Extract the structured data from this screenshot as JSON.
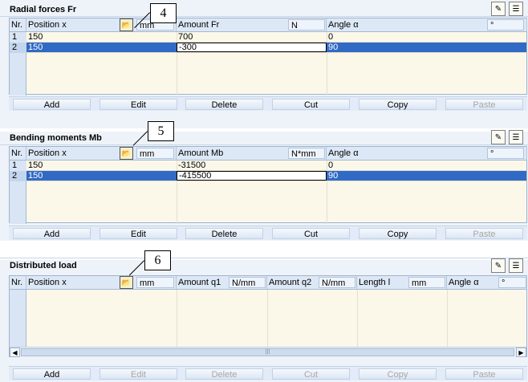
{
  "icons": {
    "pick": "folder-pick-icon",
    "edit_chart": "chart-edit-icon",
    "notes": "notes-icon"
  },
  "buttons": [
    {
      "label": "Add"
    },
    {
      "label": "Edit"
    },
    {
      "label": "Delete"
    },
    {
      "label": "Cut"
    },
    {
      "label": "Copy"
    },
    {
      "label": "Paste"
    }
  ],
  "radial": {
    "title": "Radial forces Fr",
    "callout": "4",
    "headers": {
      "nr": "Nr.",
      "pos": "Position x",
      "pos_unit": "mm",
      "amount": "Amount Fr",
      "amount_unit": "N",
      "angle": "Angle α",
      "angle_unit": "°"
    },
    "rows": [
      {
        "nr": "1",
        "pos": "150",
        "amount": "700",
        "angle": "0"
      },
      {
        "nr": "2",
        "pos": "150",
        "amount": "-300",
        "angle": "90"
      }
    ]
  },
  "bending": {
    "title": "Bending moments Mb",
    "callout": "5",
    "headers": {
      "nr": "Nr.",
      "pos": "Position x",
      "pos_unit": "mm",
      "amount": "Amount Mb",
      "amount_unit": "N*mm",
      "angle": "Angle α",
      "angle_unit": "°"
    },
    "rows": [
      {
        "nr": "1",
        "pos": "150",
        "amount": "-31500",
        "angle": "0"
      },
      {
        "nr": "2",
        "pos": "150",
        "amount": "-415500",
        "angle": "90"
      }
    ]
  },
  "distributed": {
    "title": "Distributed load",
    "callout": "6",
    "headers": {
      "nr": "Nr.",
      "pos": "Position x",
      "pos_unit": "mm",
      "q1": "Amount q1",
      "q1_unit": "N/mm",
      "q2": "Amount q2",
      "q2_unit": "N/mm",
      "len": "Length l",
      "len_unit": "mm",
      "angle": "Angle α",
      "angle_unit": "°"
    },
    "scroll_thumb": "|||"
  }
}
